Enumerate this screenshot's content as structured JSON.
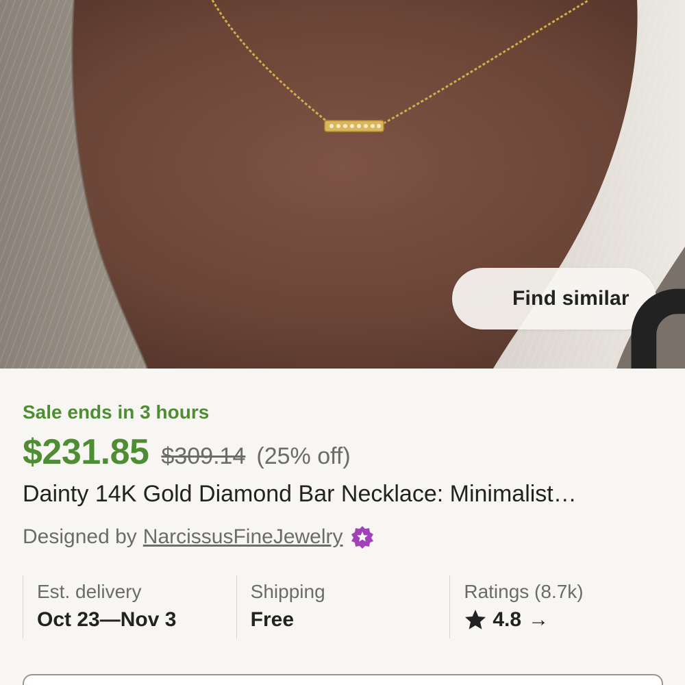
{
  "photo": {
    "alt": "Model wearing gold diamond bar necklace",
    "find_similar_label": "Find similar",
    "find_similar_icon": "visual-search-icon"
  },
  "listing": {
    "sale_text": "Sale ends in 3 hours",
    "price": "$231.85",
    "original_price": "$309.14",
    "discount": "(25% off)",
    "title": "Dainty 14K Gold Diamond Bar Necklace: Minimalist…",
    "designed_by_label": "Designed by",
    "shop_name": "NarcissusFineJewelry",
    "shop_badge_icon": "star-seller-badge-icon"
  },
  "stats": {
    "delivery": {
      "label": "Est. delivery",
      "value": "Oct 23—Nov 3"
    },
    "shipping": {
      "label": "Shipping",
      "value": "Free"
    },
    "ratings": {
      "label": "Ratings (8.7k)",
      "value": "4.8",
      "icon": "star-icon",
      "arrow": "→"
    }
  },
  "colors": {
    "sale_green": "#4f8d35",
    "badge_purple": "#a043b8",
    "text_primary": "#222222",
    "text_secondary": "#6b6b6b",
    "background": "#f8f6f2"
  }
}
